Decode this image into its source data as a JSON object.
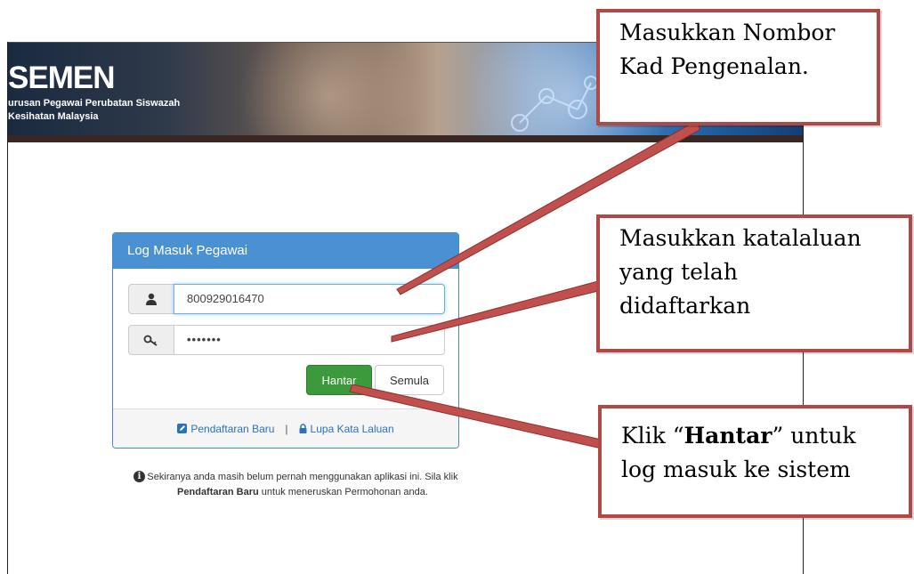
{
  "banner": {
    "title": "SEMEN",
    "subtitle_line1": "urusan Pegawai Perubatan Siswazah",
    "subtitle_line2": "Kesihatan Malaysia"
  },
  "login": {
    "header": "Log Masuk Pegawai",
    "username_value": "800929016470",
    "password_value": "•••••••",
    "user_icon": "user-icon",
    "key_icon": "key-icon",
    "submit_label": "Hantar",
    "reset_label": "Semula",
    "register_label": "Pendaftaran Baru",
    "separator": "|",
    "forgot_label": "Lupa Kata Laluan"
  },
  "info": {
    "icon": "info-icon",
    "text_before": "Sekiranya anda masih belum pernah menggunakan aplikasi ini. Sila klik ",
    "text_bold": "Pendaftaran Baru",
    "text_after": " untuk meneruskan Permohonan anda."
  },
  "annotations": {
    "callout1_line1": "Masukkan Nombor",
    "callout1_line2": "Kad Pengenalan.",
    "callout2_line1": "Masukkan katalaluan",
    "callout2_line2": "yang telah",
    "callout2_line3": "didaftarkan",
    "callout3_prefix": "Klik “",
    "callout3_bold": "Hantar",
    "callout3_suffix": "” untuk",
    "callout3_line2": "log masuk ke sistem",
    "color": "#b24844"
  },
  "colors": {
    "panel_header": "#4a91d4",
    "submit_button": "#3c9a3c",
    "link": "#2a73b8"
  }
}
